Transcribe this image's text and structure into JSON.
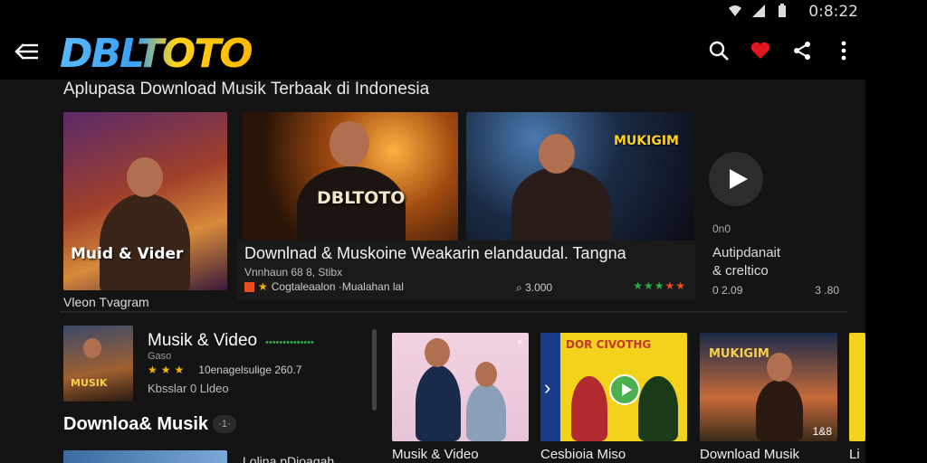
{
  "status_bar": {
    "time": "0:8:22",
    "icons": [
      "wifi-icon",
      "signal-icon",
      "battery-icon"
    ]
  },
  "header": {
    "logo_text": "DBLTOTO",
    "actions": [
      "search-icon",
      "heart-icon",
      "share-icon",
      "more-vert-icon"
    ],
    "colors": {
      "heart": "#e0161f",
      "logo_blue": "#3aa0f0",
      "logo_yellow": "#ffc400"
    }
  },
  "subtitle": "Aplupasa Download Musik Terbaak di Indonesia",
  "featured": {
    "card_a": {
      "overlay": "Muid & Vider",
      "caption": "Vleon Tvagram"
    },
    "card_b": {
      "overlay": "DBLTOTO"
    },
    "card_c": {
      "overlay": "MUKIGIM"
    },
    "wide": {
      "title": "Downlnad & Muskoine Weakarin elandaudal. Tangna",
      "subtitle": "Vnnhaun 68 8, Stibx",
      "author": "Cogtaleaalon ·Mualahan lal",
      "views": "3.000",
      "stars": "★★★★★"
    },
    "side": {
      "small": "0n0",
      "title_line1": "Autipdanait",
      "title_line2": "& creltico",
      "meta_left": "0 2.09",
      "meta_right": "3 .80"
    }
  },
  "list": {
    "item": {
      "thumb_text": "MUSIK",
      "title": "Musik & Video",
      "dots": "••••••••••••••",
      "sub": "Gaso",
      "stars": "★★★",
      "rating_text": "10enagelsulige 260.7",
      "meta": "Kbsslar 0 Lldeo"
    }
  },
  "section": {
    "title": "Downloa& Musik",
    "badge": "·1·",
    "bottom_text": "Lolina pDioagah"
  },
  "grid": [
    {
      "caption": "Musik & Video",
      "close": "×"
    },
    {
      "caption": "Cesbioia Miso",
      "inner_title": "DOR CIVOTHG"
    },
    {
      "caption": "Download Musik",
      "overlay": "MUKIGIM",
      "tag": "1&8"
    },
    {
      "caption": "Li"
    }
  ]
}
